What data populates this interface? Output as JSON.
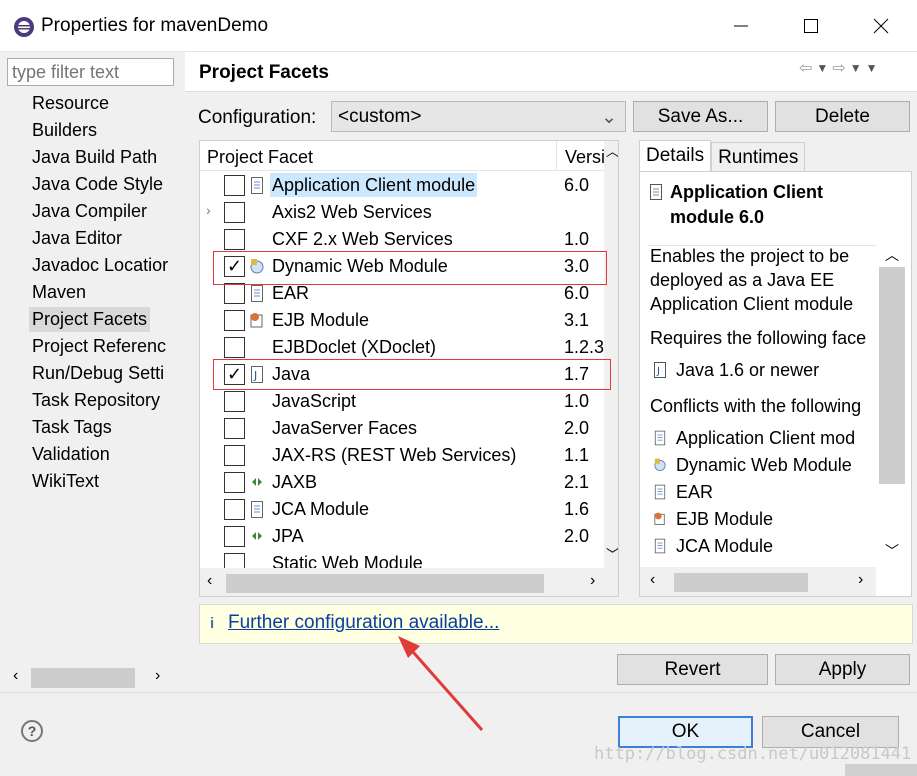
{
  "window": {
    "title": "Properties for mavenDemo"
  },
  "left": {
    "filter_placeholder": "type filter text",
    "items": [
      {
        "label": "Resource"
      },
      {
        "label": "Builders"
      },
      {
        "label": "Java Build Path"
      },
      {
        "label": "Java Code Style"
      },
      {
        "label": "Java Compiler"
      },
      {
        "label": "Java Editor"
      },
      {
        "label": "Javadoc Locatior"
      },
      {
        "label": "Maven"
      },
      {
        "label": "Project Facets",
        "selected": true
      },
      {
        "label": "Project Referenc"
      },
      {
        "label": "Run/Debug Setti"
      },
      {
        "label": "Task Repository"
      },
      {
        "label": "Task Tags"
      },
      {
        "label": "Validation"
      },
      {
        "label": "WikiText"
      }
    ]
  },
  "page": {
    "title": "Project Facets",
    "config_label": "Configuration:",
    "config_value": "<custom>",
    "save_as": "Save As...",
    "delete": "Delete"
  },
  "facets": {
    "col_facet": "Project Facet",
    "col_version": "Versi",
    "rows": [
      {
        "name": "Application Client module",
        "version": "6.0",
        "checked": false,
        "highlight": true,
        "icon": "module-icon"
      },
      {
        "name": "Axis2 Web Services",
        "version": "",
        "checked": false,
        "expandable": true,
        "icon": ""
      },
      {
        "name": "CXF 2.x Web Services",
        "version": "1.0",
        "checked": false,
        "icon": ""
      },
      {
        "name": "Dynamic Web Module",
        "version": "3.0",
        "checked": true,
        "icon": "web-module-icon"
      },
      {
        "name": "EAR",
        "version": "6.0",
        "checked": false,
        "icon": "module-icon"
      },
      {
        "name": "EJB Module",
        "version": "3.1",
        "checked": false,
        "icon": "ejb-icon"
      },
      {
        "name": "EJBDoclet (XDoclet)",
        "version": "1.2.3",
        "checked": false,
        "icon": ""
      },
      {
        "name": "Java",
        "version": "1.7",
        "checked": true,
        "icon": "java-icon"
      },
      {
        "name": "JavaScript",
        "version": "1.0",
        "checked": false,
        "icon": ""
      },
      {
        "name": "JavaServer Faces",
        "version": "2.0",
        "checked": false,
        "icon": ""
      },
      {
        "name": "JAX-RS (REST Web Services)",
        "version": "1.1",
        "checked": false,
        "icon": ""
      },
      {
        "name": "JAXB",
        "version": "2.1",
        "checked": false,
        "icon": "jaxb-icon"
      },
      {
        "name": "JCA Module",
        "version": "1.6",
        "checked": false,
        "icon": "module-icon"
      },
      {
        "name": "JPA",
        "version": "2.0",
        "checked": false,
        "icon": "jaxb-icon"
      },
      {
        "name": "Static Web Module",
        "version": "",
        "checked": false,
        "icon": ""
      }
    ]
  },
  "details": {
    "tab_details": "Details",
    "tab_runtimes": "Runtimes",
    "title": "Application Client module 6.0",
    "desc_1": "Enables the project to be",
    "desc_2": "deployed as a Java EE",
    "desc_3": "Application Client module",
    "requires": "Requires the following face",
    "requires_item": "Java 1.6 or newer",
    "conflicts": "Conflicts with the following",
    "conflict_items": [
      {
        "label": "Application Client mod",
        "icon": "module-icon"
      },
      {
        "label": "Dynamic Web Module",
        "icon": "web-module-icon"
      },
      {
        "label": "EAR",
        "icon": "module-icon"
      },
      {
        "label": "EJB Module",
        "icon": "ejb-icon"
      },
      {
        "label": "JCA Module",
        "icon": "module-icon"
      }
    ]
  },
  "info": {
    "link": "Further configuration available..."
  },
  "buttons": {
    "revert": "Revert",
    "apply": "Apply",
    "ok": "OK",
    "cancel": "Cancel"
  },
  "watermark": "http://blog.csdn.net/u012081441",
  "colors": {
    "highlight": "#cce8ff",
    "red_annotation": "#e03a3a",
    "link": "#0a3fa0",
    "info_bg": "#ffffe1"
  }
}
